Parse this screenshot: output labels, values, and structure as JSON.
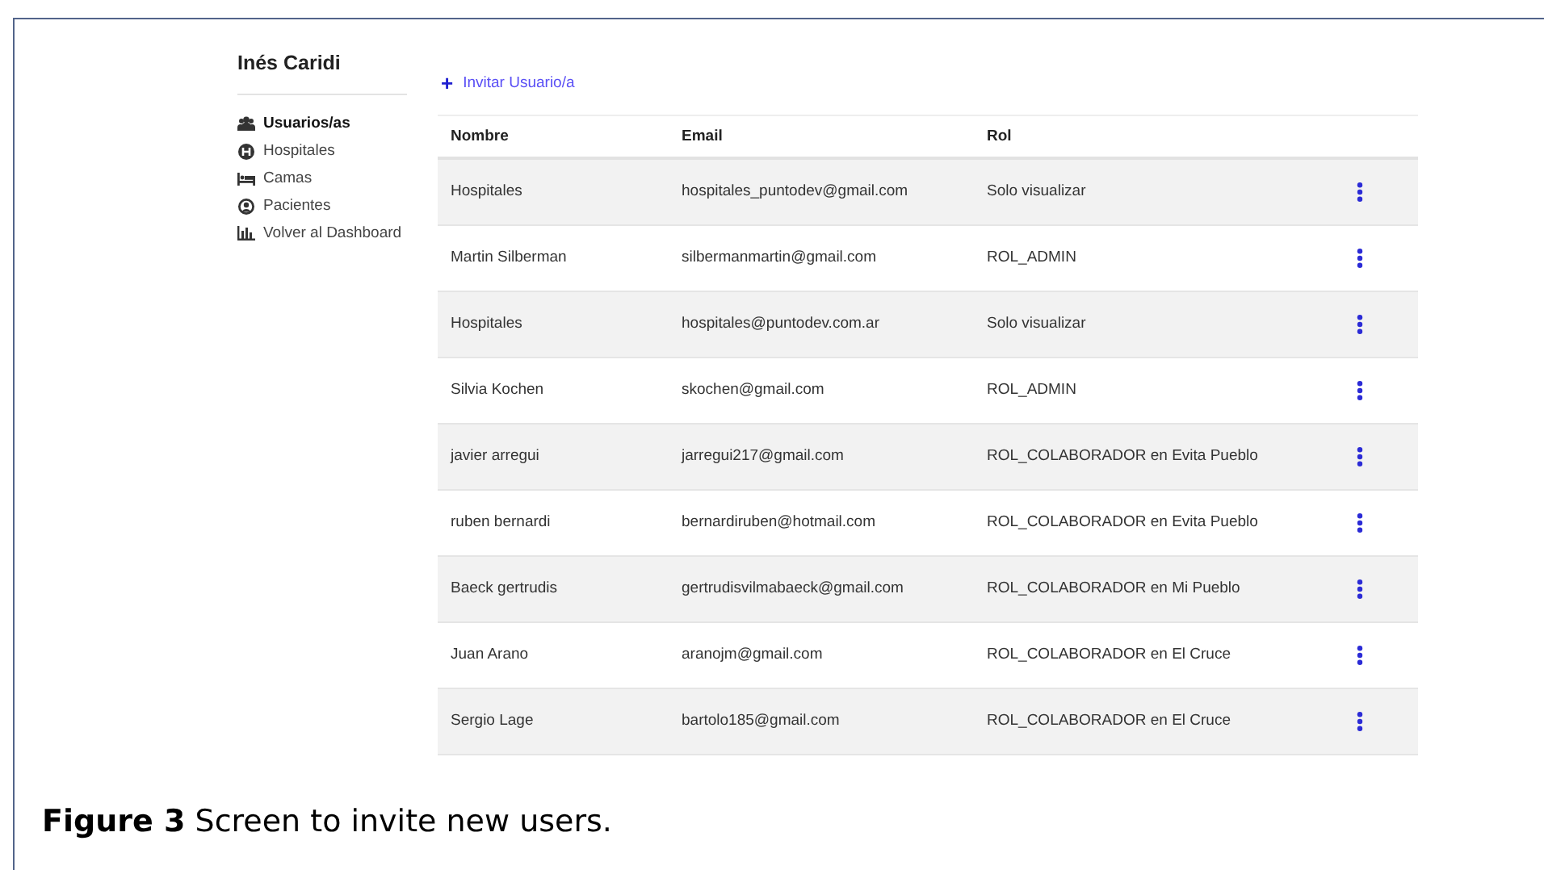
{
  "sidebar": {
    "user_name": "Inés Caridi",
    "items": [
      {
        "label": "Usuarios/as",
        "kind": "users",
        "selected": true
      },
      {
        "label": "Hospitales",
        "kind": "hospital",
        "selected": false
      },
      {
        "label": "Camas",
        "kind": "bed",
        "selected": false
      },
      {
        "label": "Pacientes",
        "kind": "patient",
        "selected": false
      },
      {
        "label": "Volver al Dashboard",
        "kind": "chart",
        "selected": false
      }
    ]
  },
  "invite_link": {
    "icon": "+",
    "label": "Invitar Usuario/a"
  },
  "table": {
    "columns": [
      "Nombre",
      "Email",
      "Rol"
    ],
    "rows": [
      {
        "name": "Hospitales",
        "email": "hospitales_puntodev@gmail.com",
        "role": "Solo visualizar"
      },
      {
        "name": "Martin Silberman",
        "email": "silbermanmartin@gmail.com",
        "role": "ROL_ADMIN"
      },
      {
        "name": "Hospitales",
        "email": "hospitales@puntodev.com.ar",
        "role": "Solo visualizar"
      },
      {
        "name": "Silvia Kochen",
        "email": "skochen@gmail.com",
        "role": "ROL_ADMIN"
      },
      {
        "name": "javier arregui",
        "email": "jarregui217@gmail.com",
        "role": "ROL_COLABORADOR en Evita Pueblo"
      },
      {
        "name": "ruben bernardi",
        "email": "bernardiruben@hotmail.com",
        "role": "ROL_COLABORADOR en Evita Pueblo"
      },
      {
        "name": "Baeck gertrudis",
        "email": "gertrudisvilmabaeck@gmail.com",
        "role": "ROL_COLABORADOR en Mi Pueblo"
      },
      {
        "name": "Juan Arano",
        "email": "aranojm@gmail.com",
        "role": "ROL_COLABORADOR en El Cruce"
      },
      {
        "name": "Sergio Lage",
        "email": "bartolo185@gmail.com",
        "role": "ROL_COLABORADOR en El Cruce"
      }
    ]
  },
  "caption": "**Figure 3** Screen to invite new users."
}
